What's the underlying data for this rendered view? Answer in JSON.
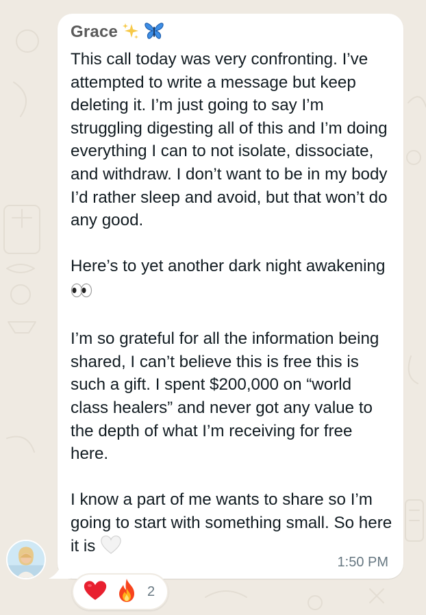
{
  "message": {
    "sender_name": "Grace",
    "sender_emojis": [
      "sparkles-icon",
      "butterfly-icon"
    ],
    "paragraphs": [
      "This call today was very confronting. I’ve attempted to write a message but keep deleting it. I’m just going to say I’m struggling digesting all of this and I’m doing everything I can to not isolate, dissociate, and withdraw. I don’t want to be in my body I’d rather sleep and avoid, but that won’t do any good.",
      "Here’s to yet another dark night awakening",
      "I’m so grateful for all the information being shared, I can’t believe this is free this is such a gift. I spent $200,000 on “world class healers” and never got any value to the depth of what I’m receiving for free here.",
      "I know a part of me wants to share so I’m going to start with something small. So here it is"
    ],
    "inline_emojis": {
      "after_paragraph_2": "eyes-icon",
      "after_paragraph_4": "white-heart-icon"
    },
    "timestamp": "1:50 PM"
  },
  "reactions": {
    "emojis": [
      "red-heart-icon",
      "fire-icon"
    ],
    "count": "2"
  },
  "colors": {
    "background": "#efeae2",
    "bubble": "#ffffff",
    "text": "#111b21",
    "meta": "#667781",
    "sender": "#5a5a5a"
  }
}
